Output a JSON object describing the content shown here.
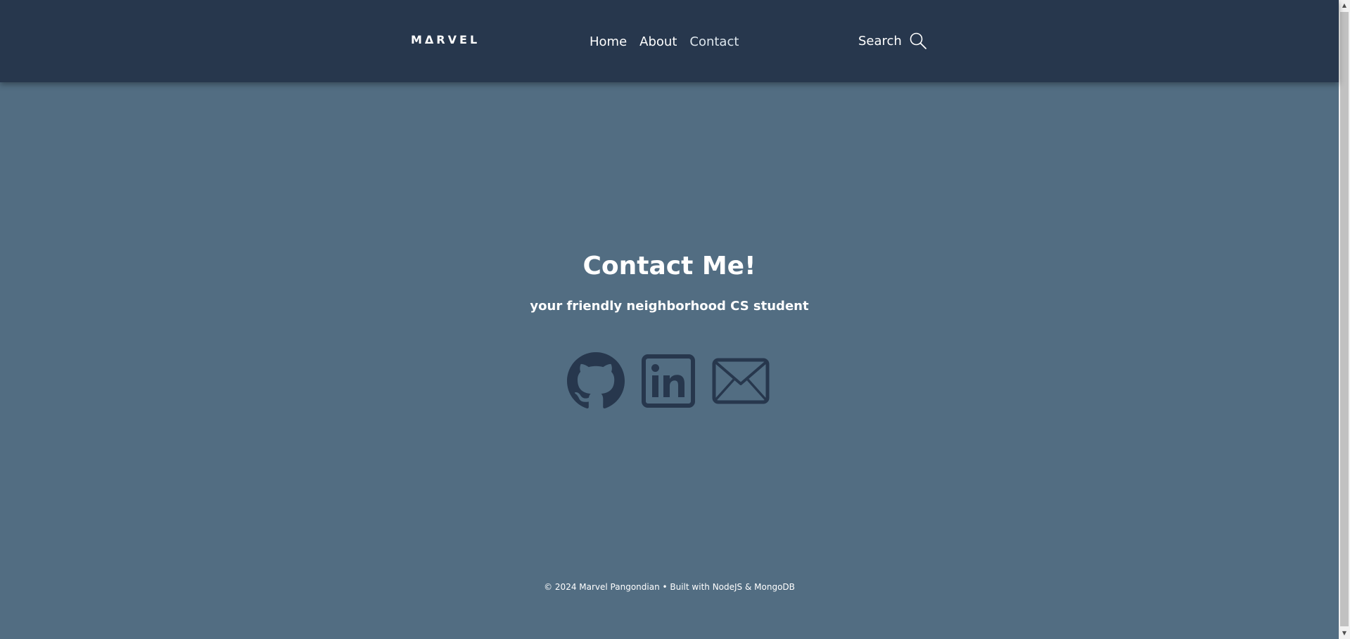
{
  "navbar": {
    "brand": "MΔRVEL",
    "links": [
      {
        "label": "Home",
        "active": false
      },
      {
        "label": "About",
        "active": false
      },
      {
        "label": "Contact",
        "active": true
      }
    ],
    "search_label": "Search",
    "search_icon": "magnifier-icon"
  },
  "contact": {
    "title": "Contact Me!",
    "subtitle": "your friendly neighborhood CS student",
    "social": [
      {
        "name": "github",
        "icon": "github-icon"
      },
      {
        "name": "linkedin",
        "icon": "linkedin-icon"
      },
      {
        "name": "email",
        "icon": "envelope-icon"
      }
    ]
  },
  "footer": {
    "text": "© 2024 Marvel Pangondian • Built with NodeJS & MongoDB"
  },
  "colors": {
    "navbar_bg": "#27374d",
    "page_bg": "#526d82",
    "text": "#ffffff",
    "active_link": "#dde6ed",
    "icon": "#27374d"
  }
}
